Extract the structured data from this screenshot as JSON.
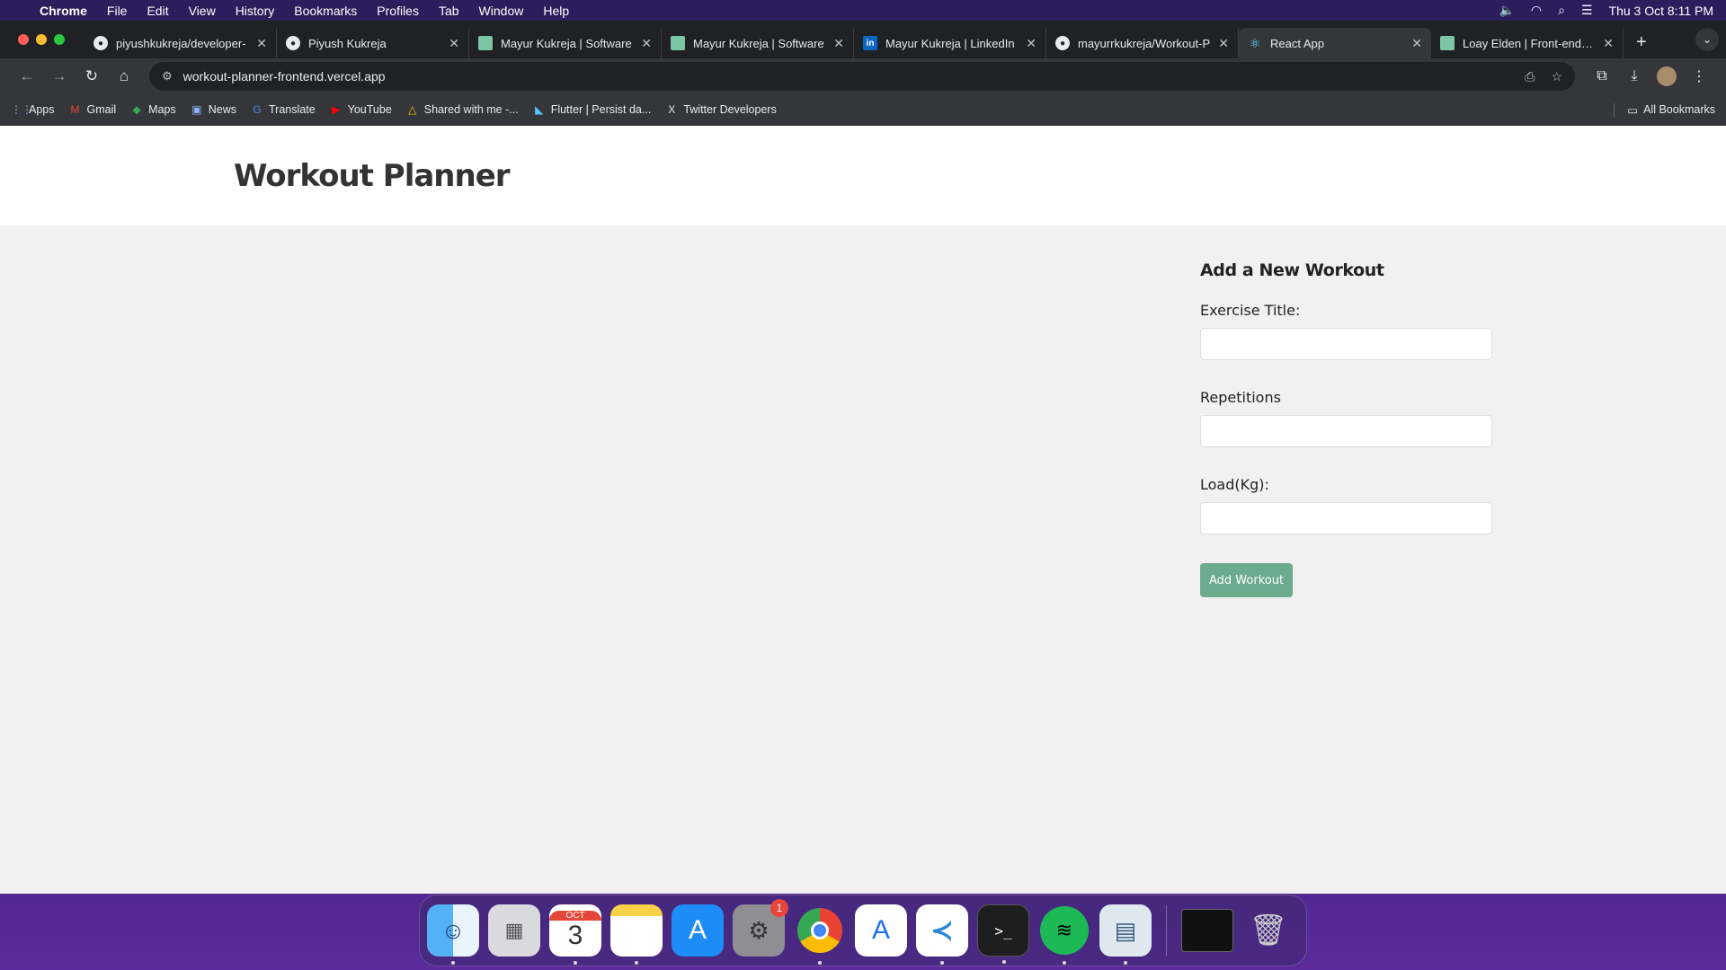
{
  "menubar": {
    "app": "Chrome",
    "items": [
      "File",
      "Edit",
      "View",
      "History",
      "Bookmarks",
      "Profiles",
      "Tab",
      "Window",
      "Help"
    ],
    "datetime": "Thu 3 Oct  8:11 PM"
  },
  "tabs": [
    {
      "title": "piyushkukreja/developer-",
      "icon": "github-icon"
    },
    {
      "title": "Piyush Kukreja",
      "icon": "profile-icon"
    },
    {
      "title": "Mayur Kukreja | Software",
      "icon": "site-icon"
    },
    {
      "title": "Mayur Kukreja | Software",
      "icon": "site-icon"
    },
    {
      "title": "Mayur Kukreja | LinkedIn",
      "icon": "linkedin-icon"
    },
    {
      "title": "mayurrkukreja/Workout-P",
      "icon": "github-icon"
    },
    {
      "title": "React App",
      "icon": "react-icon",
      "active": true
    },
    {
      "title": "Loay Elden | Front-end De",
      "icon": "site-icon"
    }
  ],
  "address": {
    "url": "workout-planner-frontend.vercel.app"
  },
  "bookmarks": {
    "items": [
      {
        "label": "Apps",
        "icon": "apps-grid-icon"
      },
      {
        "label": "Gmail",
        "icon": "gmail-icon"
      },
      {
        "label": "Maps",
        "icon": "maps-icon"
      },
      {
        "label": "News",
        "icon": "news-icon"
      },
      {
        "label": "Translate",
        "icon": "translate-icon"
      },
      {
        "label": "YouTube",
        "icon": "youtube-icon"
      },
      {
        "label": "Shared with me -...",
        "icon": "drive-icon"
      },
      {
        "label": "Flutter | Persist da...",
        "icon": "flutter-icon"
      },
      {
        "label": "Twitter Developers",
        "icon": "x-icon"
      }
    ],
    "all": "All Bookmarks"
  },
  "page": {
    "title": "Workout Planner",
    "form": {
      "heading": "Add a New Workout",
      "title_label": "Exercise Title:",
      "reps_label": "Repetitions",
      "load_label": "Load(Kg):",
      "title_value": "",
      "reps_value": "",
      "load_value": "",
      "submit": "Add Workout"
    },
    "colors": {
      "button": "#6cab8e",
      "header_bg": "#ffffff",
      "body_bg": "#f1f1f1"
    }
  },
  "dock": {
    "calendar_month": "OCT",
    "calendar_day": "3",
    "settings_badge": "1"
  }
}
